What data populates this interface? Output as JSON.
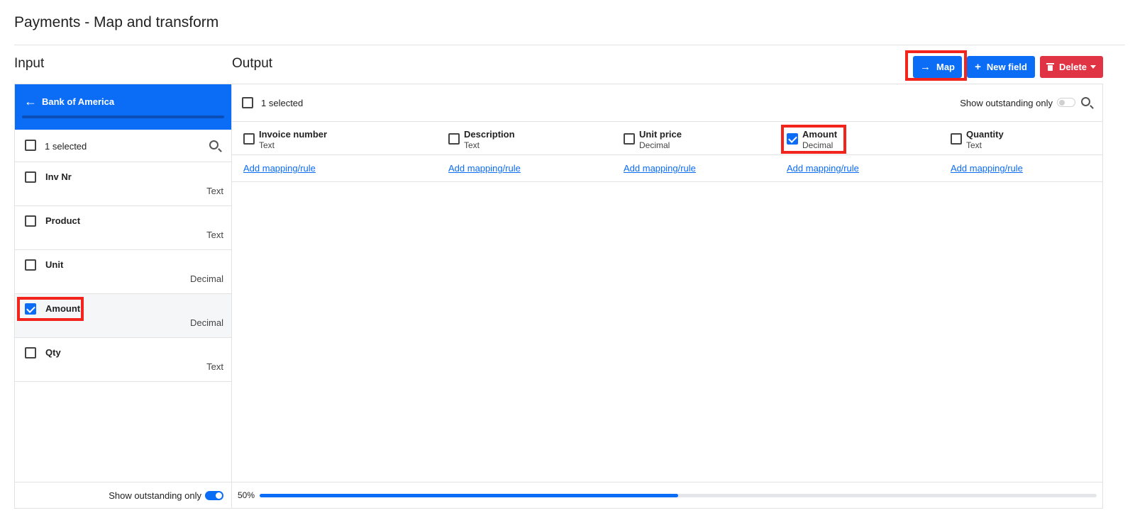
{
  "page_title": "Payments - Map and transform",
  "input": {
    "section_title": "Input",
    "source_name": "Bank of America",
    "selected_text": "1 selected",
    "fields": [
      {
        "name": "Inv Nr",
        "type": "Text",
        "checked": false
      },
      {
        "name": "Product",
        "type": "Text",
        "checked": false
      },
      {
        "name": "Unit",
        "type": "Decimal",
        "checked": false
      },
      {
        "name": "Amount",
        "type": "Decimal",
        "checked": true
      },
      {
        "name": "Qty",
        "type": "Text",
        "checked": false
      }
    ],
    "show_outstanding_label": "Show outstanding only",
    "show_outstanding_on": true
  },
  "output": {
    "section_title": "Output",
    "selected_text": "1 selected",
    "show_outstanding_label": "Show outstanding only",
    "show_outstanding_on": false,
    "columns": [
      {
        "name": "Invoice number",
        "type": "Text",
        "checked": false,
        "link": "Add mapping/rule"
      },
      {
        "name": "Description",
        "type": "Text",
        "checked": false,
        "link": "Add mapping/rule"
      },
      {
        "name": "Unit price",
        "type": "Decimal",
        "checked": false,
        "link": "Add mapping/rule"
      },
      {
        "name": "Amount",
        "type": "Decimal",
        "checked": true,
        "link": "Add mapping/rule"
      },
      {
        "name": "Quantity",
        "type": "Text",
        "checked": false,
        "link": "Add mapping/rule"
      }
    ],
    "progress_label": "50%",
    "progress_value": 0.5
  },
  "toolbar": {
    "map_label": "Map",
    "new_field_label": "New field",
    "delete_label": "Delete"
  },
  "icons": {
    "map": "arrow-right-icon",
    "new_field": "plus-icon",
    "delete": "trash-icon",
    "back": "arrow-left-icon",
    "search": "search-icon"
  },
  "colors": {
    "primary": "#0b6cf5",
    "danger": "#e03444",
    "highlight": "#f2241c"
  }
}
